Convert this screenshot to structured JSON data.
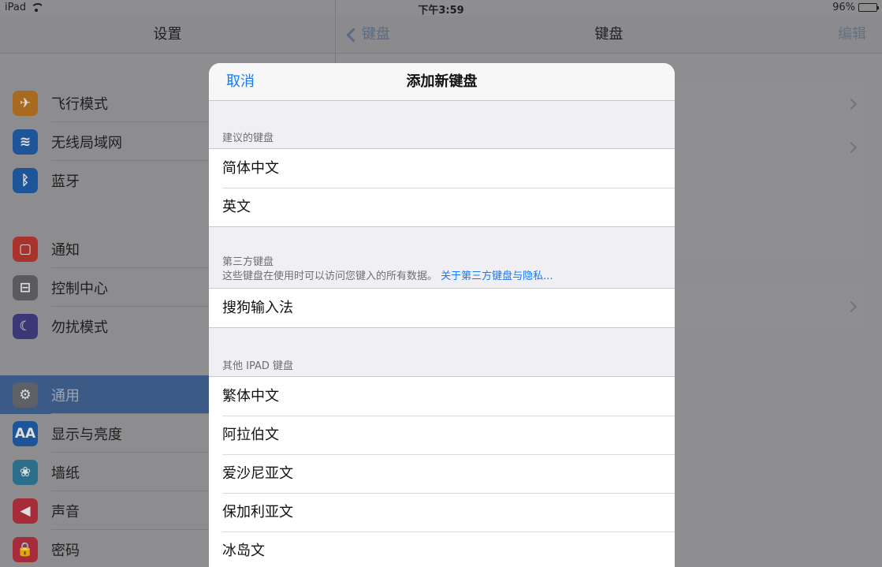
{
  "status_bar": {
    "device": "iPad",
    "time": "下午3:59",
    "battery": "96%",
    "battery_level": 0.96
  },
  "master": {
    "title": "设置",
    "groups": [
      {
        "items": [
          {
            "label": "飞行模式",
            "icon": "airplane-icon",
            "color": "#a86a1e",
            "glyph": "✈"
          },
          {
            "label": "无线局域网",
            "icon": "wifi-icon",
            "color": "#1d5598",
            "glyph": "≋"
          },
          {
            "label": "蓝牙",
            "icon": "bluetooth-icon",
            "color": "#1d5598",
            "glyph": "ᛒ"
          }
        ]
      },
      {
        "items": [
          {
            "label": "通知",
            "icon": "notifications-icon",
            "color": "#a8332d",
            "glyph": "▢"
          },
          {
            "label": "控制中心",
            "icon": "control-center-icon",
            "color": "#5b5b5e",
            "glyph": "⊟"
          },
          {
            "label": "勿扰模式",
            "icon": "moon-icon",
            "color": "#3c3878",
            "glyph": "☾"
          }
        ]
      },
      {
        "items": [
          {
            "label": "通用",
            "icon": "gear-icon",
            "color": "#5e6068",
            "glyph": "⚙",
            "selected": true
          },
          {
            "label": "显示与亮度",
            "icon": "display-icon",
            "color": "#1d5598",
            "glyph": "AA"
          },
          {
            "label": "墙纸",
            "icon": "wallpaper-icon",
            "color": "#2a6e8a",
            "glyph": "❀"
          },
          {
            "label": "声音",
            "icon": "speaker-icon",
            "color": "#a62c3a",
            "glyph": "◀"
          },
          {
            "label": "密码",
            "icon": "lock-icon",
            "color": "#a62c3a",
            "glyph": "🔒"
          }
        ]
      }
    ]
  },
  "detail": {
    "back_label": "键盘",
    "title": "键盘",
    "edit_label": "编辑"
  },
  "modal": {
    "cancel_label": "取消",
    "title": "添加新键盘",
    "suggested": {
      "header": "建议的键盘",
      "items": [
        "简体中文",
        "英文"
      ]
    },
    "third_party": {
      "header": "第三方键盘",
      "note": "这些键盘在使用时可以访问您键入的所有数据。",
      "link": "关于第三方键盘与隐私...",
      "items": [
        "搜狗输入法"
      ]
    },
    "other": {
      "header": "其他 IPAD 键盘",
      "items": [
        "繁体中文",
        "阿拉伯文",
        "爱沙尼亚文",
        "保加利亚文",
        "冰岛文"
      ]
    }
  },
  "colors": {
    "accent": "#1479fb",
    "selected_row": "#3b5a86"
  }
}
